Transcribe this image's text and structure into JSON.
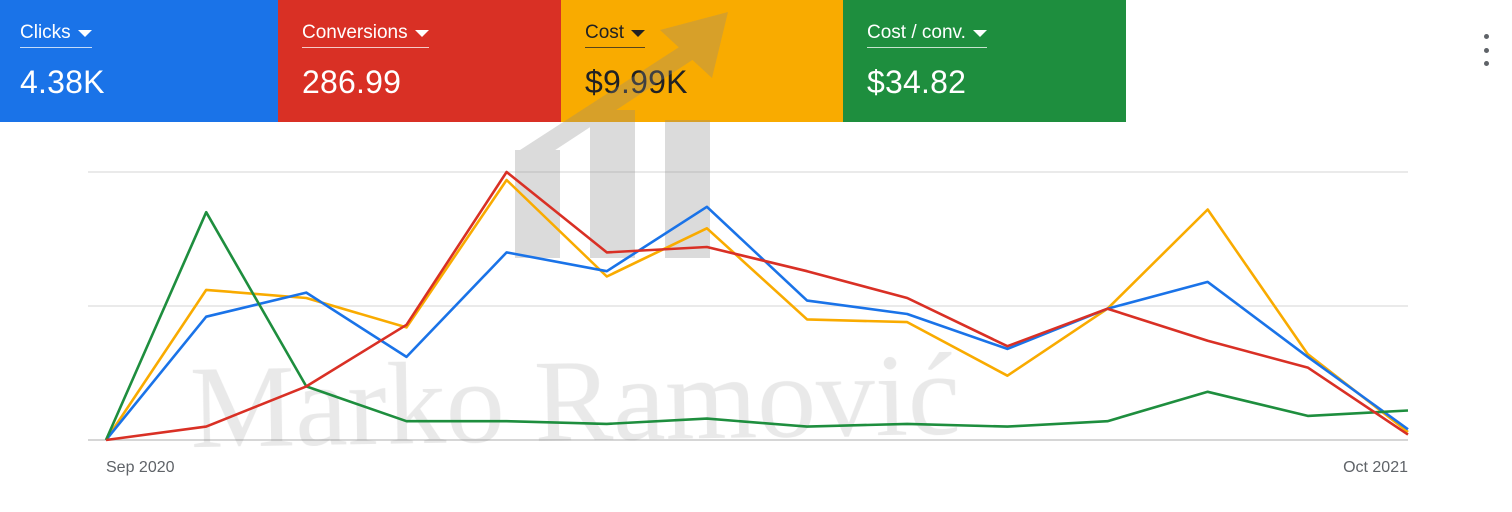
{
  "scorecards": [
    {
      "label": "Clicks",
      "value": "4.38K",
      "color": "#1a73e8"
    },
    {
      "label": "Conversions",
      "value": "286.99",
      "color": "#d93025"
    },
    {
      "label": "Cost",
      "value": "$9.99K",
      "color": "#f9ab00"
    },
    {
      "label": "Cost / conv.",
      "value": "$34.82",
      "color": "#1e8e3e"
    }
  ],
  "menu_icon": "more-vert-icon",
  "watermark": {
    "text": "Marko Ramović"
  },
  "chart_data": {
    "type": "line",
    "title": "",
    "xlabel": "",
    "ylabel": "",
    "x_tick_labels": [
      "Sep 2020",
      "Oct 2021"
    ],
    "grid": true,
    "ylim": [
      0,
      100
    ],
    "x": [
      0,
      1,
      2,
      3,
      4,
      5,
      6,
      7,
      8,
      9,
      10,
      11,
      12,
      13
    ],
    "series": [
      {
        "name": "Clicks",
        "color": "#1a73e8",
        "values": [
          0,
          46,
          55,
          31,
          70,
          63,
          87,
          52,
          47,
          34,
          49,
          59,
          31,
          4
        ]
      },
      {
        "name": "Conversions",
        "color": "#d93025",
        "values": [
          0,
          5,
          20,
          43,
          100,
          70,
          72,
          63,
          53,
          35,
          49,
          37,
          27,
          2
        ]
      },
      {
        "name": "Cost",
        "color": "#f9ab00",
        "values": [
          0,
          56,
          53,
          42,
          97,
          61,
          79,
          45,
          44,
          24,
          49,
          86,
          32,
          3
        ]
      },
      {
        "name": "Cost / conv.",
        "color": "#1e8e3e",
        "values": [
          0,
          85,
          20,
          7,
          7,
          6,
          8,
          5,
          6,
          5,
          7,
          18,
          9,
          11
        ]
      }
    ]
  }
}
